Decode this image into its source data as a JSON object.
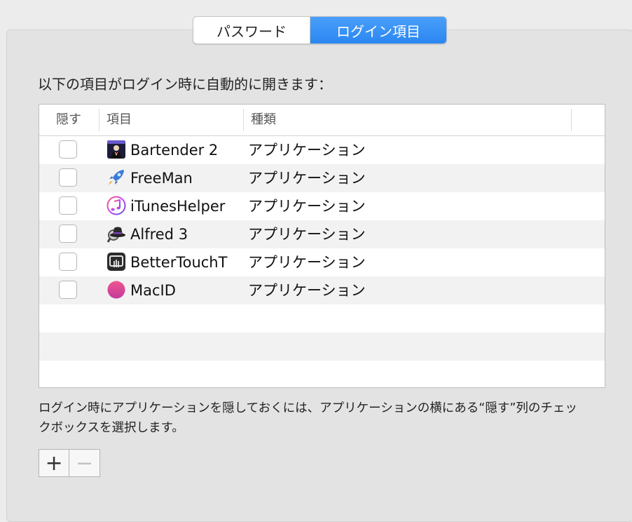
{
  "tabs": [
    {
      "label": "パスワード",
      "selected": false
    },
    {
      "label": "ログイン項目",
      "selected": true
    }
  ],
  "heading": "以下の項目がログイン時に自動的に開きます：",
  "table": {
    "columns": [
      "隠す",
      "項目",
      "種類"
    ],
    "rows": [
      {
        "hide": false,
        "name": "Bartender 2",
        "kind": "アプリケーション",
        "icon": "bartender-icon"
      },
      {
        "hide": false,
        "name": "FreeMan",
        "kind": "アプリケーション",
        "icon": "rocket-icon"
      },
      {
        "hide": false,
        "name": "iTunesHelper",
        "kind": "アプリケーション",
        "icon": "itunes-icon"
      },
      {
        "hide": false,
        "name": "Alfred 3",
        "kind": "アプリケーション",
        "icon": "alfred-hat-icon"
      },
      {
        "hide": false,
        "name": "BetterTouchT",
        "kind": "アプリケーション",
        "icon": "bettertouchtool-icon"
      },
      {
        "hide": false,
        "name": "MacID",
        "kind": "アプリケーション",
        "icon": "macid-icon"
      }
    ]
  },
  "note": "ログイン時にアプリケーションを隠しておくには、アプリケーションの横にある“隠す”列のチェックボックスを選択します。",
  "buttons": {
    "add": "+",
    "remove": "−"
  },
  "colors": {
    "accent": "#2a86f2",
    "row_alt": "#f2f2f2",
    "pane": "#e3e3e3"
  }
}
